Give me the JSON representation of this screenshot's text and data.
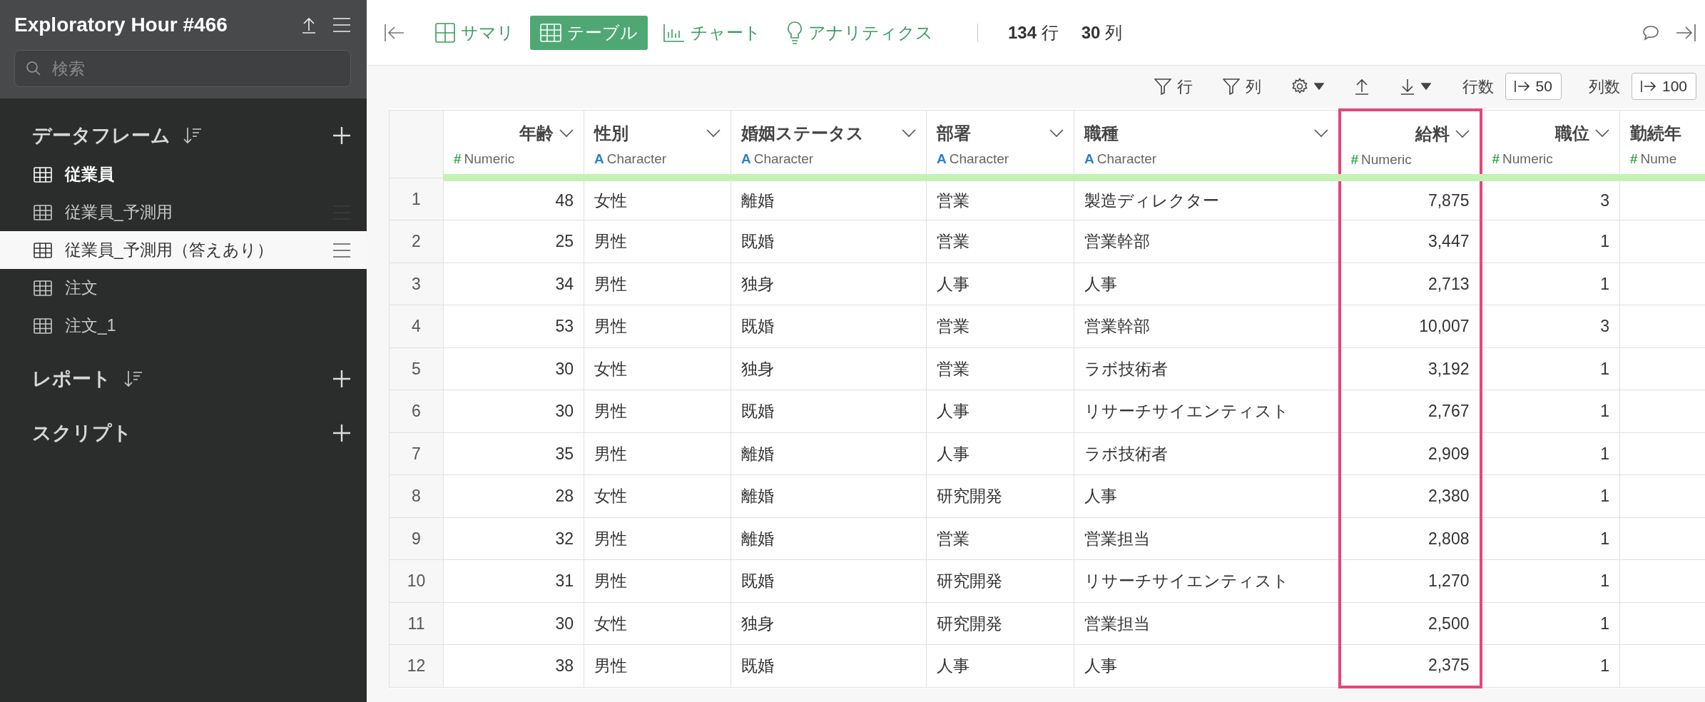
{
  "project": {
    "title": "Exploratory Hour #466"
  },
  "search": {
    "placeholder": "検索"
  },
  "sections": [
    {
      "title": "データフレーム",
      "sortable": true,
      "items": [
        {
          "label": "従業員",
          "active": true,
          "selected": false
        },
        {
          "label": "従業員_予測用",
          "active": false,
          "selected": false,
          "menu_visible": true
        },
        {
          "label": "従業員_予測用（答えあり）",
          "active": false,
          "selected": true,
          "menu_visible": true
        },
        {
          "label": "注文",
          "active": false,
          "selected": false
        },
        {
          "label": "注文_1",
          "active": false,
          "selected": false
        }
      ]
    },
    {
      "title": "レポート",
      "sortable": true
    },
    {
      "title": "スクリプト",
      "sortable": false
    }
  ],
  "tabs": [
    {
      "kind": "summary",
      "label": "サマリ",
      "selected": false
    },
    {
      "kind": "table",
      "label": "テーブル",
      "selected": true
    },
    {
      "kind": "chart",
      "label": "チャート",
      "selected": false
    },
    {
      "kind": "analytics",
      "label": "アナリティクス",
      "selected": false
    }
  ],
  "counts": [
    {
      "value": "134",
      "unit": "行"
    },
    {
      "value": "30",
      "unit": "列"
    }
  ],
  "actions": [
    {
      "kind": "filter",
      "label": "行"
    },
    {
      "kind": "filter",
      "label": "列"
    },
    {
      "kind": "settings",
      "caret": true
    },
    {
      "kind": "upload",
      "caret": false
    },
    {
      "kind": "download",
      "caret": true
    }
  ],
  "limits": [
    {
      "label": "行数",
      "value": "50"
    },
    {
      "label": "列数",
      "value": "100"
    }
  ],
  "table": {
    "columns": [
      {
        "name": "年齢",
        "kind": "numeric",
        "type_icon": "#",
        "type": "Numeric",
        "highlighted": false
      },
      {
        "name": "性別",
        "kind": "character",
        "type_icon": "A",
        "type": "Character",
        "highlighted": false
      },
      {
        "name": "婚姻ステータス",
        "kind": "character",
        "type_icon": "A",
        "type": "Character",
        "highlighted": false
      },
      {
        "name": "部署",
        "kind": "character",
        "type_icon": "A",
        "type": "Character",
        "highlighted": false
      },
      {
        "name": "職種",
        "kind": "character",
        "type_icon": "A",
        "type": "Character",
        "highlighted": false
      },
      {
        "name": "給料",
        "kind": "numeric",
        "type_icon": "#",
        "type": "Numeric",
        "highlighted": true
      },
      {
        "name": "職位",
        "kind": "numeric",
        "type_icon": "#",
        "type": "Numeric",
        "highlighted": false
      },
      {
        "name": "勤続年",
        "kind": "partial",
        "type_icon": "#",
        "type": "Nume",
        "highlighted": false
      }
    ],
    "rows": [
      {
        "index": "1",
        "cells": [
          "48",
          "女性",
          "離婚",
          "営業",
          "製造ディレクター",
          "7,875",
          "3"
        ]
      },
      {
        "index": "2",
        "cells": [
          "25",
          "男性",
          "既婚",
          "営業",
          "営業幹部",
          "3,447",
          "1"
        ]
      },
      {
        "index": "3",
        "cells": [
          "34",
          "男性",
          "独身",
          "人事",
          "人事",
          "2,713",
          "1"
        ]
      },
      {
        "index": "4",
        "cells": [
          "53",
          "男性",
          "既婚",
          "営業",
          "営業幹部",
          "10,007",
          "3"
        ]
      },
      {
        "index": "5",
        "cells": [
          "30",
          "女性",
          "独身",
          "営業",
          "ラボ技術者",
          "3,192",
          "1"
        ]
      },
      {
        "index": "6",
        "cells": [
          "30",
          "男性",
          "既婚",
          "人事",
          "リサーチサイエンティスト",
          "2,767",
          "1"
        ]
      },
      {
        "index": "7",
        "cells": [
          "35",
          "男性",
          "離婚",
          "人事",
          "ラボ技術者",
          "2,909",
          "1"
        ]
      },
      {
        "index": "8",
        "cells": [
          "28",
          "女性",
          "離婚",
          "研究開発",
          "人事",
          "2,380",
          "1"
        ]
      },
      {
        "index": "9",
        "cells": [
          "32",
          "男性",
          "離婚",
          "営業",
          "営業担当",
          "2,808",
          "1"
        ]
      },
      {
        "index": "10",
        "cells": [
          "31",
          "男性",
          "既婚",
          "研究開発",
          "リサーチサイエンティスト",
          "1,270",
          "1"
        ]
      },
      {
        "index": "11",
        "cells": [
          "30",
          "女性",
          "独身",
          "研究開発",
          "営業担当",
          "2,500",
          "1"
        ]
      },
      {
        "index": "12",
        "cells": [
          "38",
          "男性",
          "既婚",
          "人事",
          "人事",
          "2,375",
          "1"
        ]
      }
    ]
  }
}
